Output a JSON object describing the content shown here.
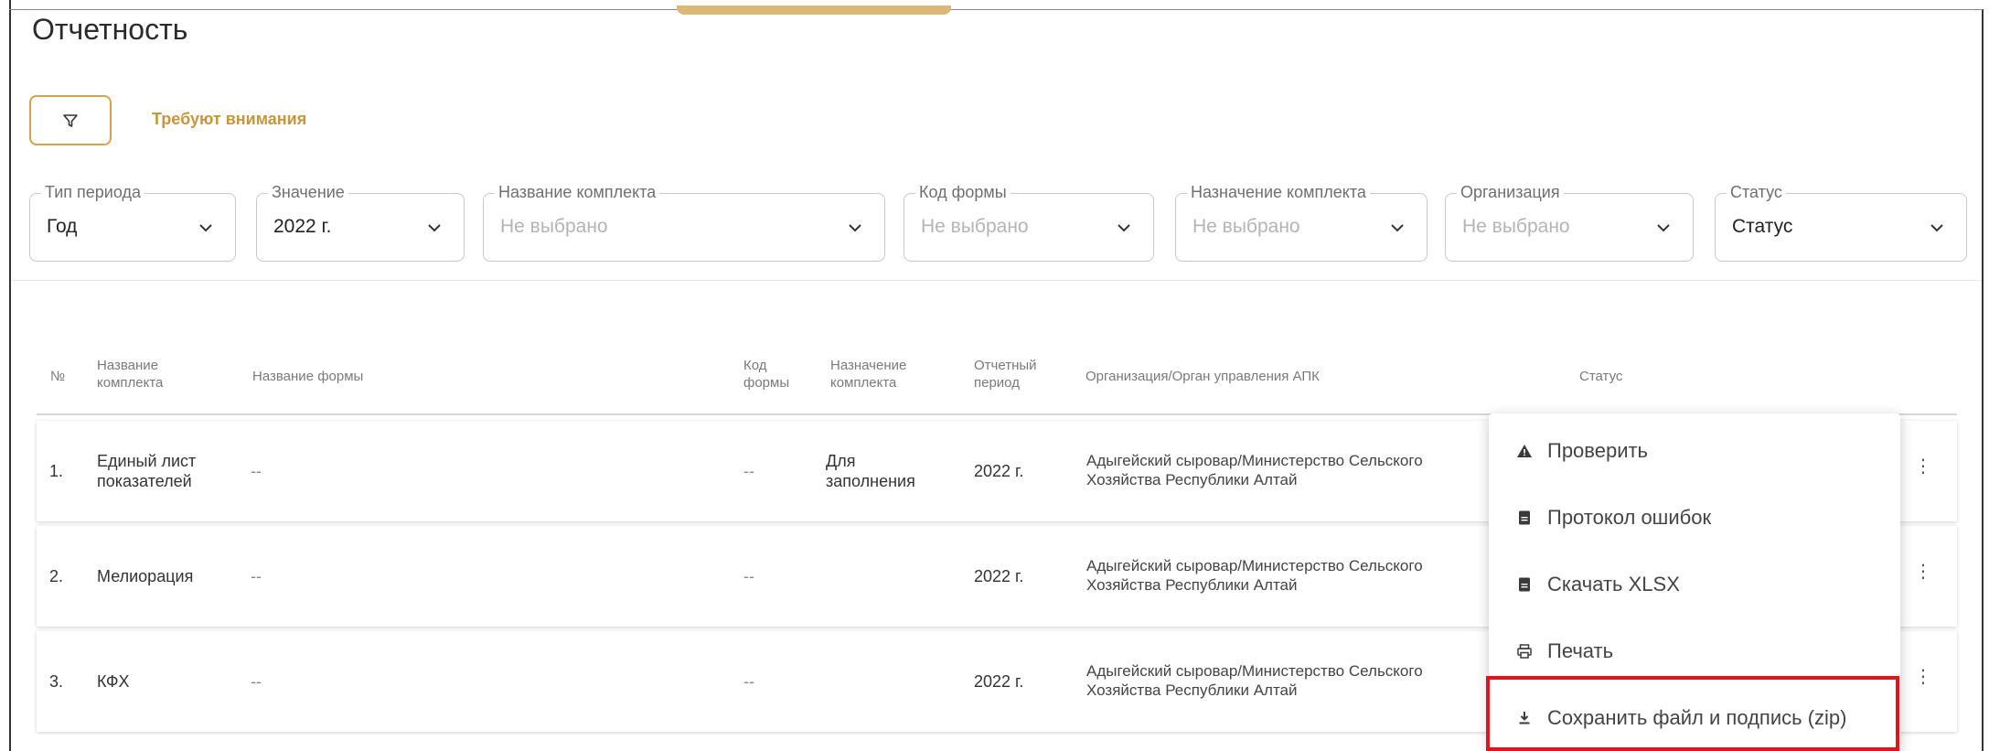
{
  "page": {
    "title": "Отчетность"
  },
  "toolbar": {
    "filter_icon": "filter-icon",
    "attention_label": "Требуют внимания"
  },
  "filters": [
    {
      "label": "Тип периода",
      "value": "Год"
    },
    {
      "label": "Значение",
      "value": "2022 г."
    },
    {
      "label": "Название комплекта",
      "value": "Не выбрано"
    },
    {
      "label": "Код формы",
      "value": "Не выбрано"
    },
    {
      "label": "Назначение комплекта",
      "value": "Не выбрано"
    },
    {
      "label": "Организация",
      "value": "Не выбрано"
    },
    {
      "label": "Статус",
      "value": "Статус"
    }
  ],
  "table": {
    "headers": {
      "num": "№",
      "set_name_1": "Название",
      "set_name_2": "комплекта",
      "form_name": "Название формы",
      "form_code_1": "Код",
      "form_code_2": "формы",
      "purpose_1": "Назначение",
      "purpose_2": "комплекта",
      "period_1": "Отчетный",
      "period_2": "период",
      "org": "Организация/Орган управления АПК",
      "status": "Статус"
    },
    "rows": [
      {
        "num": "1.",
        "set_name_1": "Единый лист",
        "set_name_2": "показателей",
        "form_name": "--",
        "form_code": "--",
        "purpose_1": "Для",
        "purpose_2": "заполнения",
        "period": "2022 г.",
        "org_1": "Адыгейский сыровар/Министерство Сельского",
        "org_2": "Хозяйства Республики Алтай"
      },
      {
        "num": "2.",
        "set_name_1": "Мелиорация",
        "set_name_2": "",
        "form_name": "--",
        "form_code": "--",
        "purpose_1": "",
        "purpose_2": "",
        "period": "2022 г.",
        "org_1": "Адыгейский сыровар/Министерство Сельского",
        "org_2": "Хозяйства Республики Алтай"
      },
      {
        "num": "3.",
        "set_name_1": "КФХ",
        "set_name_2": "",
        "form_name": "--",
        "form_code": "--",
        "purpose_1": "",
        "purpose_2": "",
        "period": "2022 г.",
        "org_1": "Адыгейский сыровар/Министерство Сельского",
        "org_2": "Хозяйства Республики Алтай"
      }
    ]
  },
  "context_menu": {
    "items": [
      {
        "label": "Проверить",
        "icon": "warning-icon"
      },
      {
        "label": "Протокол ошибок",
        "icon": "document-icon"
      },
      {
        "label": "Скачать XLSX",
        "icon": "document-icon"
      },
      {
        "label": "Печать",
        "icon": "printer-icon"
      },
      {
        "label": "Сохранить файл и подпись (zip)",
        "icon": "download-icon"
      }
    ],
    "highlight_color": "#e3121b"
  },
  "colors": {
    "accent": "#c9953c",
    "accent_border": "#d3a44c"
  }
}
